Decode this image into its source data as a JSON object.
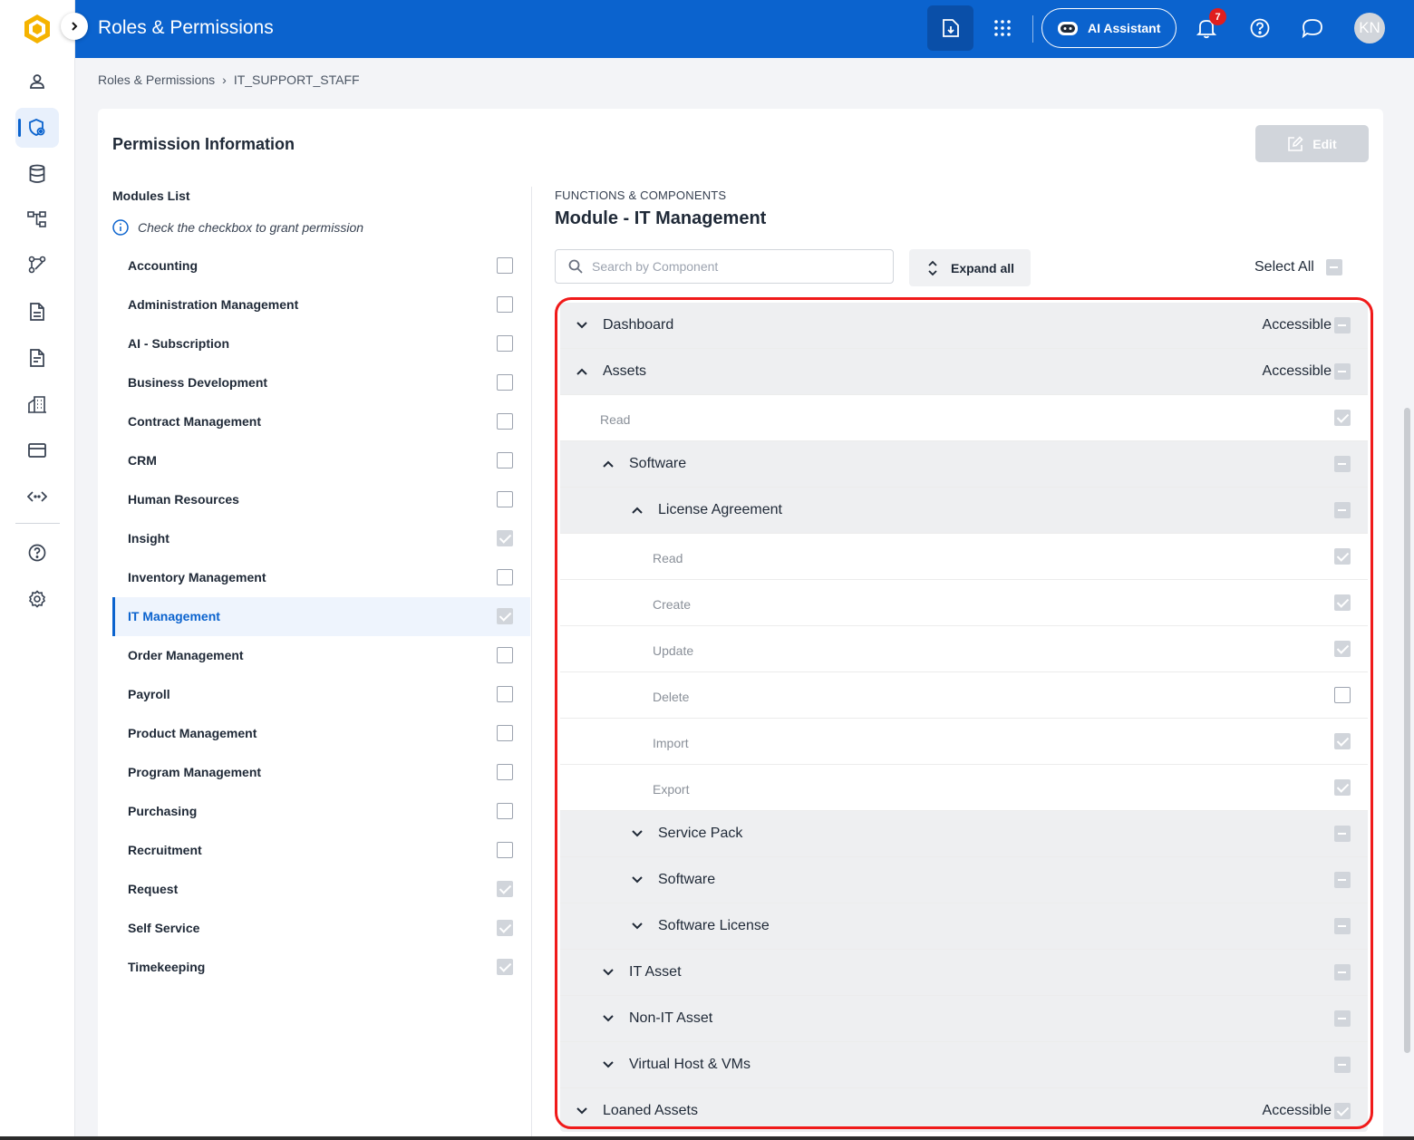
{
  "topbar": {
    "title": "Roles & Permissions",
    "ai_label": "AI Assistant",
    "notification_count": "7",
    "avatar_initials": "KN",
    "bg_color": "#0b63ce"
  },
  "breadcrumb": {
    "root": "Roles & Permissions",
    "separator": "›",
    "current": "IT_SUPPORT_STAFF"
  },
  "card": {
    "title": "Permission Information",
    "edit_label": "Edit"
  },
  "modules": {
    "heading": "Modules List",
    "hint": "Check the checkbox to grant permission",
    "items": [
      {
        "label": "Accounting",
        "state": "unchecked"
      },
      {
        "label": "Administration Management",
        "state": "unchecked"
      },
      {
        "label": "AI - Subscription",
        "state": "unchecked"
      },
      {
        "label": "Business Development",
        "state": "unchecked"
      },
      {
        "label": "Contract Management",
        "state": "unchecked"
      },
      {
        "label": "CRM",
        "state": "unchecked"
      },
      {
        "label": "Human Resources",
        "state": "unchecked"
      },
      {
        "label": "Insight",
        "state": "checked"
      },
      {
        "label": "Inventory Management",
        "state": "unchecked"
      },
      {
        "label": "IT Management",
        "state": "checked",
        "active": true
      },
      {
        "label": "Order Management",
        "state": "unchecked"
      },
      {
        "label": "Payroll",
        "state": "unchecked"
      },
      {
        "label": "Product Management",
        "state": "unchecked"
      },
      {
        "label": "Program Management",
        "state": "unchecked"
      },
      {
        "label": "Purchasing",
        "state": "unchecked"
      },
      {
        "label": "Recruitment",
        "state": "unchecked"
      },
      {
        "label": "Request",
        "state": "checked"
      },
      {
        "label": "Self Service",
        "state": "checked"
      },
      {
        "label": "Timekeeping",
        "state": "checked"
      }
    ]
  },
  "functions": {
    "overline": "FUNCTIONS & COMPONENTS",
    "title": "Module - IT Management",
    "search_placeholder": "Search by Component",
    "expand_label": "Expand all",
    "select_all_label": "Select All",
    "tree": [
      {
        "label": "Dashboard",
        "type": "group",
        "level": 0,
        "expanded": false,
        "status": "Accessible",
        "state": "partial"
      },
      {
        "label": "Assets",
        "type": "group",
        "level": 0,
        "expanded": true,
        "status": "Accessible",
        "state": "partial"
      },
      {
        "label": "Read",
        "type": "leaf",
        "level": 1,
        "state": "checked"
      },
      {
        "label": "Software",
        "type": "group",
        "level": 1,
        "expanded": true,
        "status": "",
        "state": "partial"
      },
      {
        "label": "License Agreement",
        "type": "group",
        "level": 2,
        "expanded": true,
        "status": "",
        "state": "partial"
      },
      {
        "label": "Read",
        "type": "leaf",
        "level": 3,
        "state": "checked"
      },
      {
        "label": "Create",
        "type": "leaf",
        "level": 3,
        "state": "checked"
      },
      {
        "label": "Update",
        "type": "leaf",
        "level": 3,
        "state": "checked"
      },
      {
        "label": "Delete",
        "type": "leaf",
        "level": 3,
        "state": "unchecked"
      },
      {
        "label": "Import",
        "type": "leaf",
        "level": 3,
        "state": "checked"
      },
      {
        "label": "Export",
        "type": "leaf",
        "level": 3,
        "state": "checked"
      },
      {
        "label": "Service Pack",
        "type": "group",
        "level": 2,
        "expanded": false,
        "status": "",
        "state": "partial"
      },
      {
        "label": "Software",
        "type": "group",
        "level": 2,
        "expanded": false,
        "status": "",
        "state": "partial"
      },
      {
        "label": "Software License",
        "type": "group",
        "level": 2,
        "expanded": false,
        "status": "",
        "state": "partial"
      },
      {
        "label": "IT Asset",
        "type": "group",
        "level": 1,
        "expanded": false,
        "status": "",
        "state": "partial"
      },
      {
        "label": "Non-IT Asset",
        "type": "group",
        "level": 1,
        "expanded": false,
        "status": "",
        "state": "partial"
      },
      {
        "label": "Virtual Host & VMs",
        "type": "group",
        "level": 1,
        "expanded": false,
        "status": "",
        "state": "partial"
      },
      {
        "label": "Loaned Assets",
        "type": "group",
        "level": 0,
        "expanded": false,
        "status": "Accessible",
        "state": "checked"
      }
    ]
  },
  "rail": {
    "items": [
      {
        "icon": "user-icon"
      },
      {
        "icon": "shield-lock-icon",
        "active": true
      },
      {
        "icon": "database-icon"
      },
      {
        "icon": "org-chart-icon"
      },
      {
        "icon": "workflow-icon"
      },
      {
        "icon": "document-icon"
      },
      {
        "icon": "report-icon"
      },
      {
        "icon": "building-icon"
      },
      {
        "icon": "card-icon"
      },
      {
        "icon": "code-icon"
      },
      {
        "icon": "help-icon"
      },
      {
        "icon": "settings-icon"
      }
    ]
  }
}
